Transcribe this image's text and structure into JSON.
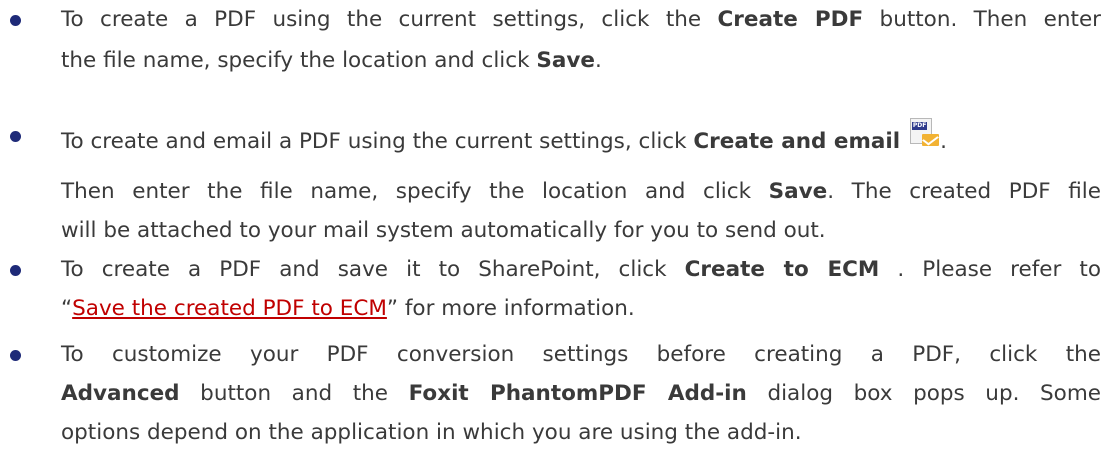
{
  "items": [
    {
      "line1": {
        "t1": "To create a PDF using the current settings, click the ",
        "b1": "Create PDF",
        "t2": " button. Then enter"
      },
      "line2": {
        "t1": "the file name, specify the location and click ",
        "b1": "Save",
        "t2": "."
      }
    },
    {
      "line1": {
        "t1": "To create and email a PDF using the current settings, click ",
        "b1": "Create and email",
        "icon": "pdf-email-icon",
        "t2": "."
      },
      "line2": {
        "t1": "Then enter the file name, specify the location and click ",
        "b1": "Save",
        "t2": ". The created PDF file"
      },
      "line3": {
        "t1": "will be attached to your mail system automatically for you to send out."
      }
    },
    {
      "line1": {
        "t1": "To create a PDF and save it to SharePoint, click ",
        "b1": "Create to ECM",
        "t2": " . Please refer to"
      },
      "line2": {
        "q1": "“",
        "link": "Save the created PDF to ECM",
        "t1": "” for more information."
      }
    },
    {
      "line1": {
        "t1": "To customize your PDF conversion settings before creating a PDF, click the"
      },
      "line2": {
        "b1": "Advanced",
        "t1": " button and the ",
        "b2": "Foxit PhantomPDF Add-in",
        "t2": " dialog box pops up. Some"
      },
      "line3": {
        "t1": "options depend on the application in which you are using the add-in."
      }
    }
  ],
  "icon_pdf_label": "PDF",
  "colors": {
    "text": "#3a3a3a",
    "bullet": "#1e2a78",
    "link": "#c00000"
  }
}
